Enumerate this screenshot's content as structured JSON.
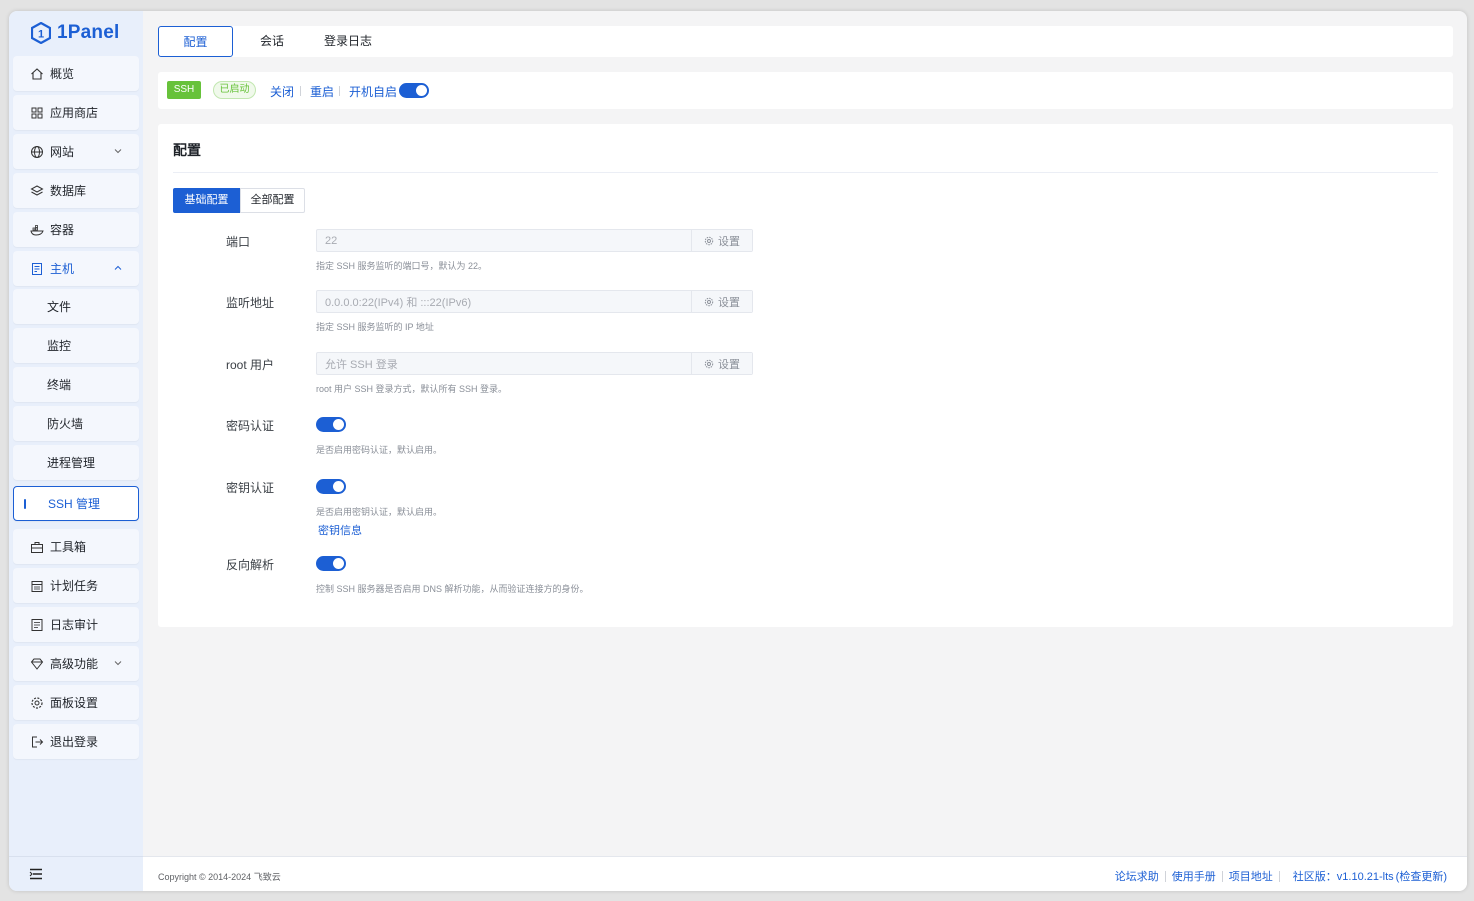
{
  "app": {
    "logo_text": "1Panel"
  },
  "sidebar": {
    "items": [
      {
        "label": "概览",
        "icon": "home-icon"
      },
      {
        "label": "应用商店",
        "icon": "grid-icon"
      },
      {
        "label": "网站",
        "icon": "globe-icon"
      },
      {
        "label": "数据库",
        "icon": "layers-icon"
      },
      {
        "label": "容器",
        "icon": "container-icon"
      },
      {
        "label": "主机",
        "icon": "host-icon"
      },
      {
        "label": "文件"
      },
      {
        "label": "监控"
      },
      {
        "label": "终端"
      },
      {
        "label": "防火墙"
      },
      {
        "label": "进程管理"
      },
      {
        "label": "SSH 管理"
      },
      {
        "label": "工具箱",
        "icon": "toolbox-icon"
      },
      {
        "label": "计划任务",
        "icon": "calendar-icon"
      },
      {
        "label": "日志审计",
        "icon": "log-icon"
      },
      {
        "label": "高级功能",
        "icon": "diamond-icon"
      },
      {
        "label": "面板设置",
        "icon": "gear-icon"
      },
      {
        "label": "退出登录",
        "icon": "logout-icon"
      }
    ]
  },
  "tabs": [
    "配置",
    "会话",
    "登录日志"
  ],
  "status": {
    "service": "SSH",
    "state": "已启动",
    "stop": "关闭",
    "restart": "重启",
    "autostart": "开机自启"
  },
  "config": {
    "title": "配置",
    "seg_basic": "基础配置",
    "seg_all": "全部配置",
    "set_label": "设置",
    "port": {
      "label": "端口",
      "value": "22",
      "help": "指定 SSH 服务监听的端口号，默认为 22。"
    },
    "listen": {
      "label": "监听地址",
      "value": "0.0.0.0:22(IPv4) 和 :::22(IPv6)",
      "help": "指定 SSH 服务监听的 IP 地址"
    },
    "root": {
      "label": "root 用户",
      "value": "允许 SSH 登录",
      "help": "root 用户 SSH 登录方式，默认所有 SSH 登录。"
    },
    "password_auth": {
      "label": "密码认证",
      "help": "是否启用密码认证，默认启用。",
      "enabled": true
    },
    "key_auth": {
      "label": "密钥认证",
      "help": "是否启用密钥认证，默认启用。",
      "enabled": true,
      "link": "密钥信息"
    },
    "reverse_dns": {
      "label": "反向解析",
      "help": "控制 SSH 服务器是否启用 DNS 解析功能，从而验证连接方的身份。",
      "enabled": true
    }
  },
  "footer": {
    "copyright": "Copyright © 2014-2024 飞致云",
    "links": [
      "论坛求助",
      "使用手册",
      "项目地址"
    ],
    "version": "社区版：v1.10.21-lts",
    "check_update": "(检查更新)"
  },
  "colors": {
    "accent": "#1c5fd4",
    "success": "#67c23a"
  }
}
